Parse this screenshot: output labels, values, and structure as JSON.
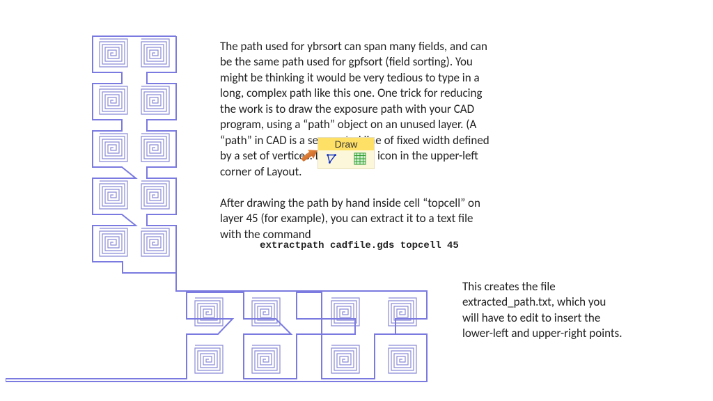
{
  "para1": "The path used for ybrsort can span many fields, and can be the same path used for gpfsort (field sorting). You might be thinking it would be very tedious to type in a long, complex path like this one. One trick for reducing the work is to draw the exposure path with your CAD program, using a “path” object on an unused layer. (A “path” in CAD is a segmented line of fixed width defined by a set of vertices. Look for this icon in the upper-left corner of Layout.",
  "drawLabel": "Draw",
  "para2": "After drawing the path by hand inside cell “topcell” on layer 45 (for example), you can extract it to a text file with the command",
  "command": "extractpath cadfile.gds topcell 45",
  "para3": "This creates the file extracted_path.txt, which you will have to edit to insert the lower-left and upper-right points.",
  "colors": {
    "spiral": "#8a8ad6",
    "path": "#7a7ae0"
  }
}
